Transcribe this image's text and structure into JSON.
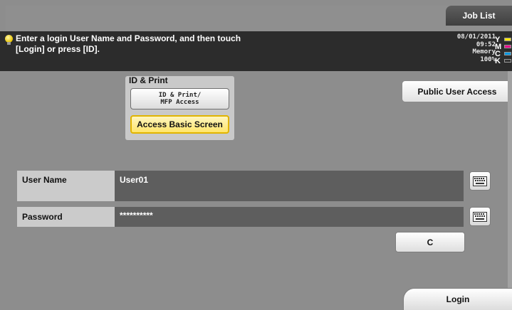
{
  "header": {
    "job_list_label": "Job List"
  },
  "message": {
    "text": "Enter a login User Name and Password, and then touch\n[Login] or press [ID]."
  },
  "status": {
    "date": "08/01/2011",
    "time": "09:52",
    "memory_label": "Memory",
    "memory_value": "100%",
    "toner": [
      {
        "letter": "Y",
        "color": "#ffe800"
      },
      {
        "letter": "M",
        "color": "#e8008a"
      },
      {
        "letter": "C",
        "color": "#0096e0"
      },
      {
        "letter": "K",
        "color": "#333333"
      }
    ]
  },
  "id_print": {
    "group_label": "ID & Print",
    "id_print_button": "ID & Print/\nMFP Access",
    "basic_screen_button": "Access Basic Screen"
  },
  "public_user_button": "Public User Access",
  "fields": {
    "user_name_label": "User Name",
    "user_name_value": "User01",
    "password_label": "Password",
    "password_value": "**********"
  },
  "icons": {
    "keyboard": "keyboard-icon",
    "bulb": "lightbulb-icon"
  },
  "clear_button": "C",
  "login_button": "Login"
}
